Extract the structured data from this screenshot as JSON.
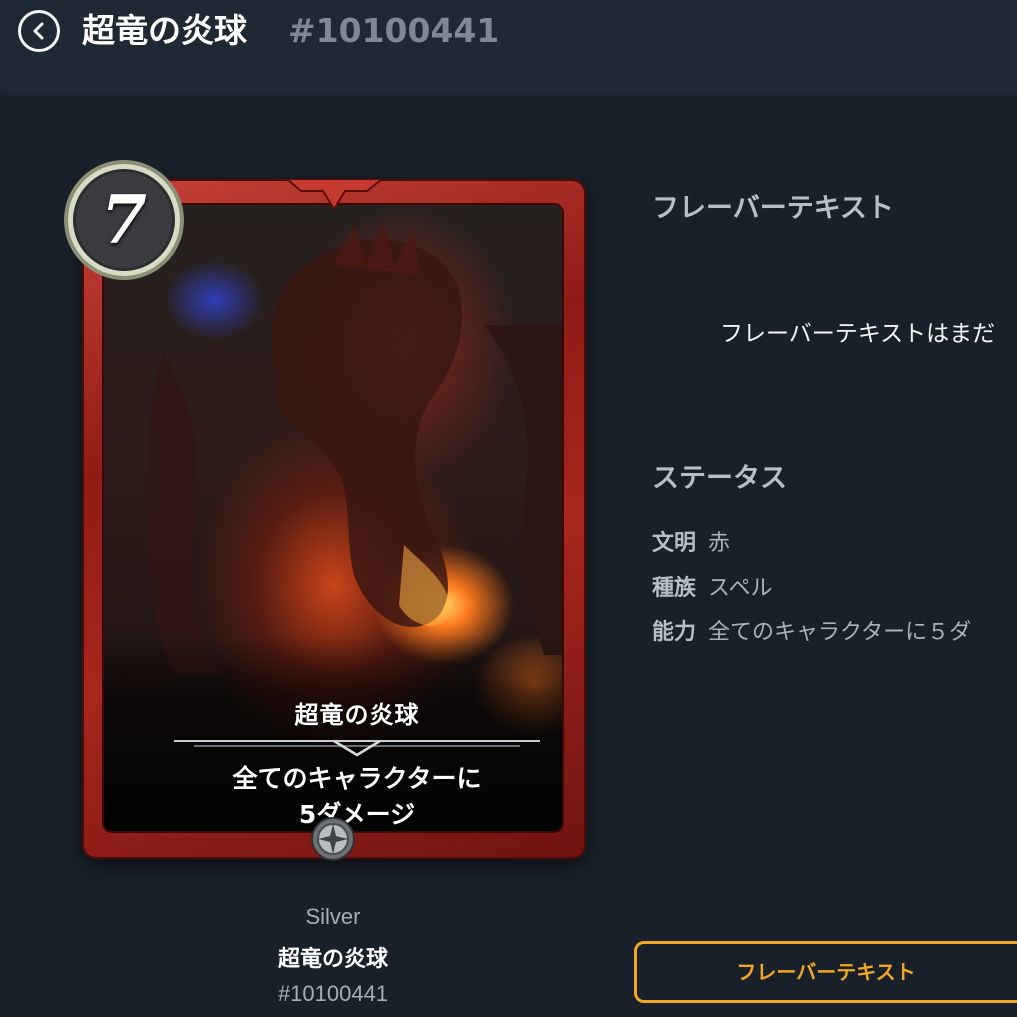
{
  "header": {
    "back_icon": "chevron-left-circle-icon",
    "title": "超竜の炎球",
    "card_id": "#10100441"
  },
  "card": {
    "cost": "7",
    "name": "超竜の炎球",
    "ability": [
      "全てのキャラクターに",
      "5ダメージ"
    ],
    "frame_color": "#a8261f",
    "rarity_icon": "rarity-gem-icon"
  },
  "caption": {
    "rarity": "Silver",
    "name": "超竜の炎球",
    "id": "#10100441"
  },
  "flavor": {
    "heading": "フレーバーテキスト",
    "body": "フレーバーテキストはまだ"
  },
  "status": {
    "heading": "ステータス",
    "rows": [
      {
        "label": "文明",
        "value": "赤"
      },
      {
        "label": "種族",
        "value": "スペル"
      },
      {
        "label": "能力",
        "value": "全てのキャラクターに５ダ"
      }
    ]
  },
  "actions": {
    "flavor_button": "フレーバーテキスト",
    "accent": "#f2a623"
  }
}
